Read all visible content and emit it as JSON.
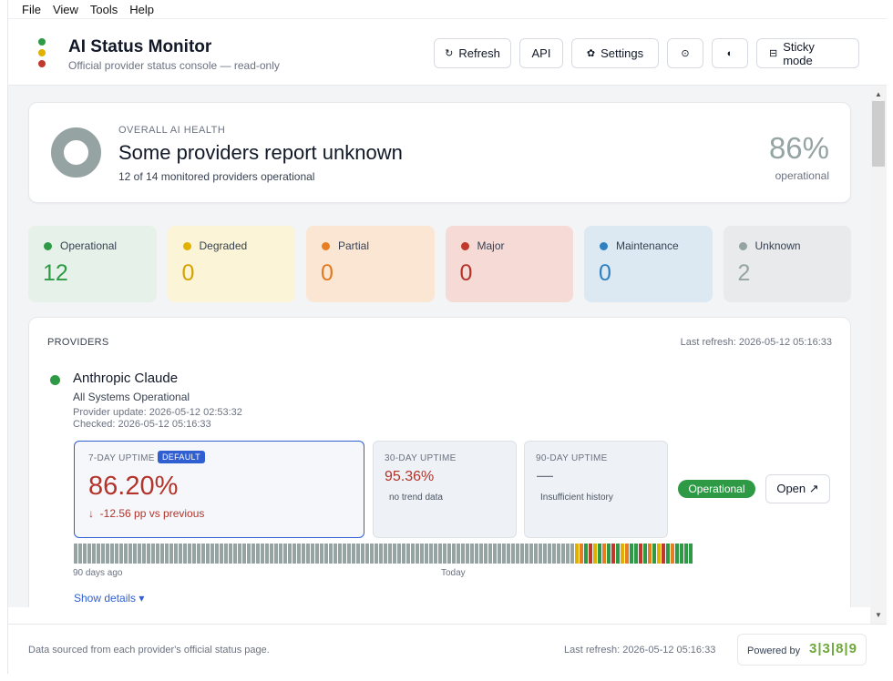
{
  "menu": [
    "File",
    "View",
    "Tools",
    "Help"
  ],
  "header": {
    "title": "AI Status Monitor",
    "subtitle": "Official provider status console — read-only",
    "logo_colors": [
      "#2e9a45",
      "#e0b100",
      "#c0392b"
    ],
    "buttons": {
      "refresh": {
        "label": "Refresh",
        "icon": "↻"
      },
      "api": {
        "label": "API"
      },
      "settings": {
        "label": "Settings",
        "icon": "✿"
      },
      "info": {
        "icon": "⊙"
      },
      "theme": {
        "icon": "◐"
      },
      "sticky": {
        "label": "Sticky mode",
        "icon": "⊟"
      }
    }
  },
  "health": {
    "label": "OVERALL AI HEALTH",
    "title": "Some providers report unknown",
    "subtitle": "12 of 14 monitored providers operational",
    "percent": "86%",
    "percent_label": "operational",
    "ring_color": "#95a3a2"
  },
  "stats": [
    {
      "label": "Operational",
      "value": "12",
      "dot": "#2e9a45",
      "bg": "#e6f2e9",
      "color": "#2e9a45"
    },
    {
      "label": "Degraded",
      "value": "0",
      "dot": "#e0b100",
      "bg": "#fbf4d6",
      "color": "#d5a300"
    },
    {
      "label": "Partial",
      "value": "0",
      "dot": "#e67e22",
      "bg": "#fbe6d3",
      "color": "#e07a20"
    },
    {
      "label": "Major",
      "value": "0",
      "dot": "#c0392b",
      "bg": "#f6dad6",
      "color": "#b4342b"
    },
    {
      "label": "Maintenance",
      "value": "0",
      "dot": "#2f80c0",
      "bg": "#dce8f2",
      "color": "#2f80c0"
    },
    {
      "label": "Unknown",
      "value": "2",
      "dot": "#95a3a2",
      "bg": "#e8eaec",
      "color": "#95a3a2"
    }
  ],
  "providers": {
    "heading": "PROVIDERS",
    "last_refresh": "Last refresh: 2026-05-12 05:16:33",
    "items": [
      {
        "name": "Anthropic Claude",
        "status": "All Systems Operational",
        "provider_update": "Provider update: 2026-05-12 02:53:32",
        "checked": "Checked: 2026-05-12 05:16:33",
        "uptime_7": {
          "label": "7-DAY UPTIME",
          "badge": "DEFAULT",
          "value": "86.20%",
          "trend": "-12.56 pp vs previous",
          "trend_icon": "↓"
        },
        "uptime_30": {
          "label": "30-DAY UPTIME",
          "value": "95.36%",
          "note": "no trend data"
        },
        "uptime_90": {
          "label": "90-DAY UPTIME",
          "value": "—",
          "note": "Insufficient history"
        },
        "badge": "Operational",
        "open_label": "Open ↗",
        "history_start": "90 days ago",
        "history_end": "Today",
        "show_details": "Show details ▾"
      }
    ]
  },
  "history_colors": {
    "unknown": "#95a3a2",
    "up": "#2e9a45",
    "degraded": "#e0b100",
    "partial": "#e67e22",
    "major": "#c0392b"
  },
  "history": "uuuuuuuuuuuuuuuuuuuuuuuuuuuuuuuuuuuuuuuuuuuuuuuuuuuuuuuuuuuuuuuuuuuuuuuuuuuuuuuuuuuuuuuuuuuuuuuuuuuuuuuuuuuuuudpgmdgpgmgdpggmgpgdmgpgggg",
  "footer": {
    "source": "Data sourced from each provider's official status page.",
    "last_refresh": "Last refresh: 2026-05-12 05:16:33",
    "powered_by": "Powered by",
    "brand": "3|3|8|9"
  }
}
